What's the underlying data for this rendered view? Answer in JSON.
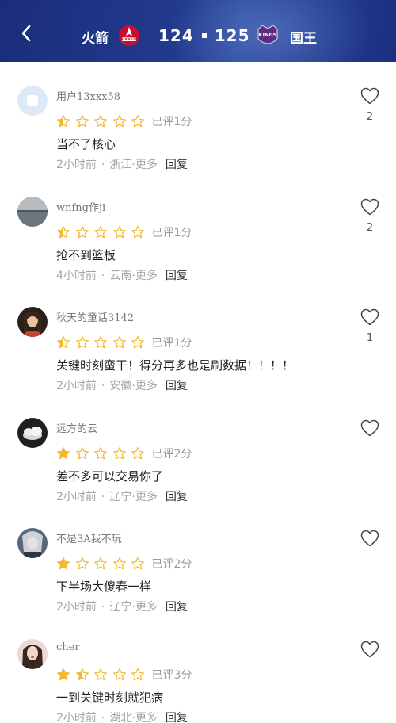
{
  "header": {
    "team_left": "火箭",
    "score": "124 · 125",
    "score_left": "124",
    "score_right": "125",
    "team_right": "国王",
    "logo_left_text": "ROCKETS",
    "logo_right_text": "KINGS",
    "bg_color": "#1b2f7c"
  },
  "colors": {
    "star": "#f5b82e",
    "text_meta": "#a5a5a5"
  },
  "rated_prefix": "已评",
  "comments": [
    {
      "user": "用户13xxx58",
      "rating": 1,
      "rating_label": "已评1分",
      "text": "当不了核心",
      "time": "2小时前",
      "location": "浙江·",
      "more": "更多",
      "reply": "回复",
      "likes": "2",
      "avatar": "default-avatar"
    },
    {
      "user": "wnfng作ji",
      "rating": 1,
      "rating_label": "已评1分",
      "text": "抢不到篮板",
      "time": "4小时前",
      "location": "云南·",
      "more": "更多",
      "reply": "回复",
      "likes": "2",
      "avatar": "lake-avatar"
    },
    {
      "user": "秋天的童话3142",
      "rating": 1,
      "rating_label": "已评1分",
      "text": "关键时刻蛮干！得分再多也是刷数据！！！！",
      "time": "2小时前",
      "location": "安徽·",
      "more": "更多",
      "reply": "回复",
      "likes": "1",
      "avatar": "girl-avatar"
    },
    {
      "user": "远方的云",
      "rating": 2,
      "rating_label": "已评2分",
      "text": "差不多可以交易你了",
      "time": "2小时前",
      "location": "辽宁·",
      "more": "更多",
      "reply": "回复",
      "likes": "",
      "avatar": "cloud-avatar"
    },
    {
      "user": "不是3A我不玩",
      "rating": 2,
      "rating_label": "已评2分",
      "text": "下半场大傻春一样",
      "time": "2小时前",
      "location": "辽宁·",
      "more": "更多",
      "reply": "回复",
      "likes": "",
      "avatar": "anime-avatar"
    },
    {
      "user": "cher",
      "rating": 3,
      "rating_label": "已评3分",
      "text": "一到关键时刻就犯病",
      "time": "2小时前",
      "location": "湖北·",
      "more": "更多",
      "reply": "回复",
      "likes": "",
      "avatar": "woman-avatar"
    }
  ]
}
